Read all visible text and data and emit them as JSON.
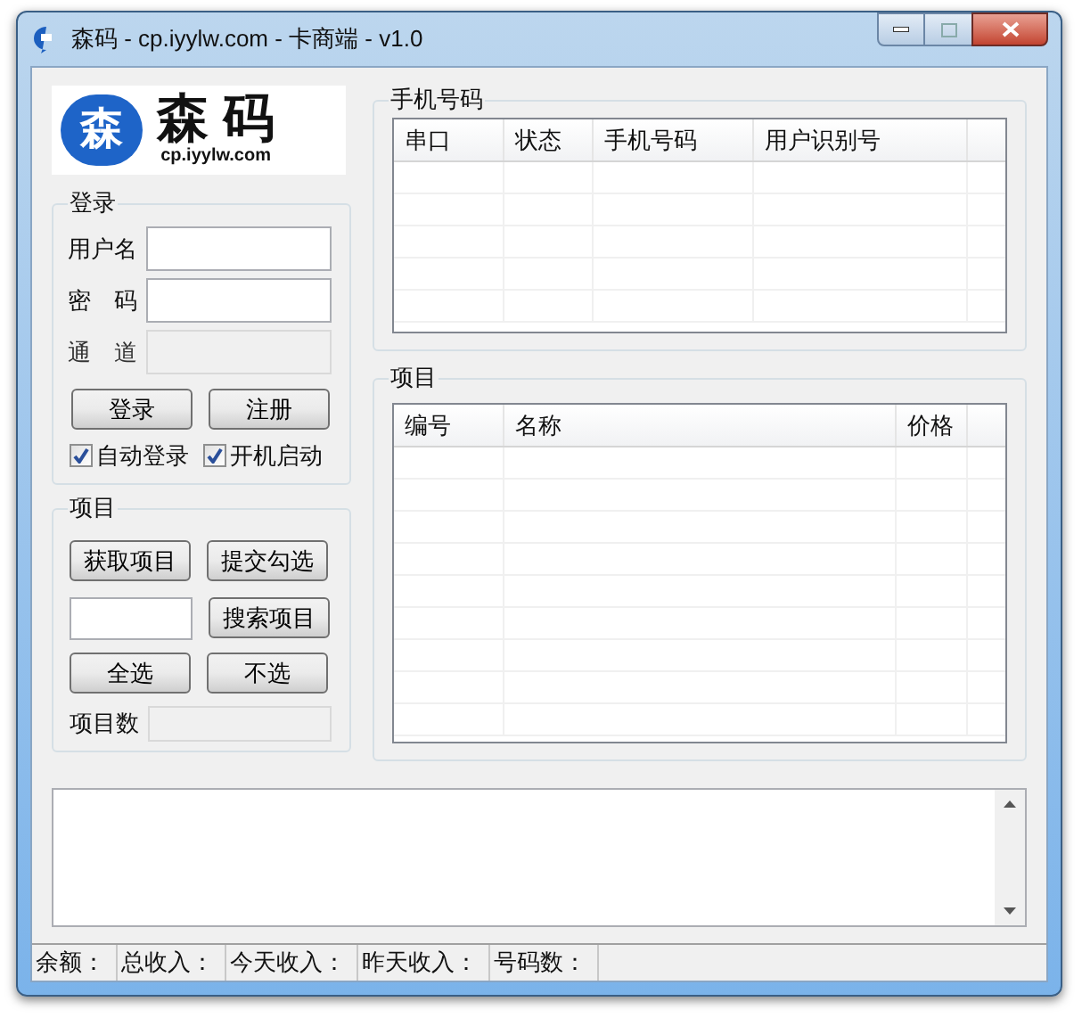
{
  "window": {
    "title": "森码 - cp.iyylw.com - 卡商端 - v1.0"
  },
  "logo": {
    "badge": "森",
    "name": "森 码",
    "url": "cp.iyylw.com"
  },
  "login": {
    "title": "登录",
    "fields": [
      {
        "label": "用户名",
        "disabled": false
      },
      {
        "label": "密　码",
        "disabled": false
      },
      {
        "label": "通　道",
        "disabled": true
      }
    ],
    "buttons": [
      "登录",
      "注册"
    ],
    "checkboxes": [
      {
        "label": "自动登录",
        "checked": true
      },
      {
        "label": "开机启动",
        "checked": true
      }
    ]
  },
  "projects": {
    "title": "项目",
    "buttons_row1": [
      "获取项目",
      "提交勾选"
    ],
    "search_button": "搜索项目",
    "buttons_row3": [
      "全选",
      "不选"
    ],
    "count_label": "项目数"
  },
  "phone_table": {
    "title": "手机号码",
    "columns": [
      "串口",
      "状态",
      "手机号码",
      "用户识别号"
    ]
  },
  "project_table": {
    "title": "项目",
    "columns": [
      "编号",
      "名称",
      "价格"
    ]
  },
  "status_bar": [
    "余额：",
    "总收入：",
    "今天收入：",
    "昨天收入：",
    "号码数："
  ]
}
